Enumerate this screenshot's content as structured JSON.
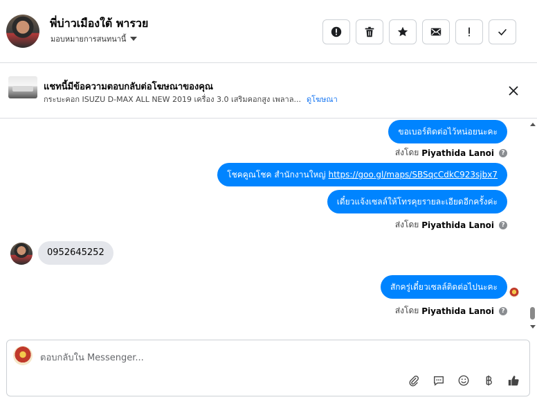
{
  "header": {
    "contact_name": "พี่บ่าวเมืองใต้ พารวย",
    "assignment": "มอบหมายการสนทนานี้",
    "actions": [
      {
        "icon": "alert-circle-icon",
        "name": "mark-spam-button"
      },
      {
        "icon": "trash-icon",
        "name": "delete-button"
      },
      {
        "icon": "star-icon",
        "name": "star-button"
      },
      {
        "icon": "envelope-icon",
        "name": "mark-unread-button"
      },
      {
        "icon": "exclamation-icon",
        "name": "follow-up-button"
      },
      {
        "icon": "check-icon",
        "name": "mark-done-button"
      }
    ]
  },
  "ad_context": {
    "title": "แชทนี้มีข้อความตอบกลับต่อโฆษณาของคุณ",
    "description": "กระบะคอก ISUZU D-MAX ALL NEW 2019 เครื่อง 3.0 เสริมคอกสูง เพลาล...",
    "link": "ดูโฆษณา"
  },
  "messages": [
    {
      "dir": "out",
      "text": "ขอเบอร์ติดต่อไว้หน่อยนะคะ"
    },
    {
      "dir": "meta",
      "prefix": "ส่งโดย",
      "sender": "Piyathida Lanoi"
    },
    {
      "dir": "out",
      "text": "โชคคูณโชค สำนักงานใหญ่ ",
      "link": "https://goo.gl/maps/SBSqcCdkC923sjbx7"
    },
    {
      "dir": "out",
      "text": "เดี๋ยวแจ้งเซลล์ให้โทรคุยรายละเอียดอีกครั้งค่ะ"
    },
    {
      "dir": "meta",
      "prefix": "ส่งโดย",
      "sender": "Piyathida Lanoi"
    },
    {
      "dir": "in",
      "text": "0952645252"
    },
    {
      "dir": "out",
      "text": "สักครู่เดี๋ยวเซลล์ติดต่อไปนะคะ"
    },
    {
      "dir": "meta",
      "prefix": "ส่งโดย",
      "sender": "Piyathida Lanoi"
    }
  ],
  "composer": {
    "placeholder": "ตอบกลับใน Messenger...",
    "tools": [
      "paperclip-icon",
      "saved-reply-icon",
      "emoji-icon",
      "baht-icon",
      "thumbs-up-icon"
    ]
  },
  "colors": {
    "outgoing_bubble": "#0084ff",
    "incoming_bubble": "#e4e6eb",
    "link": "#1877f2"
  }
}
